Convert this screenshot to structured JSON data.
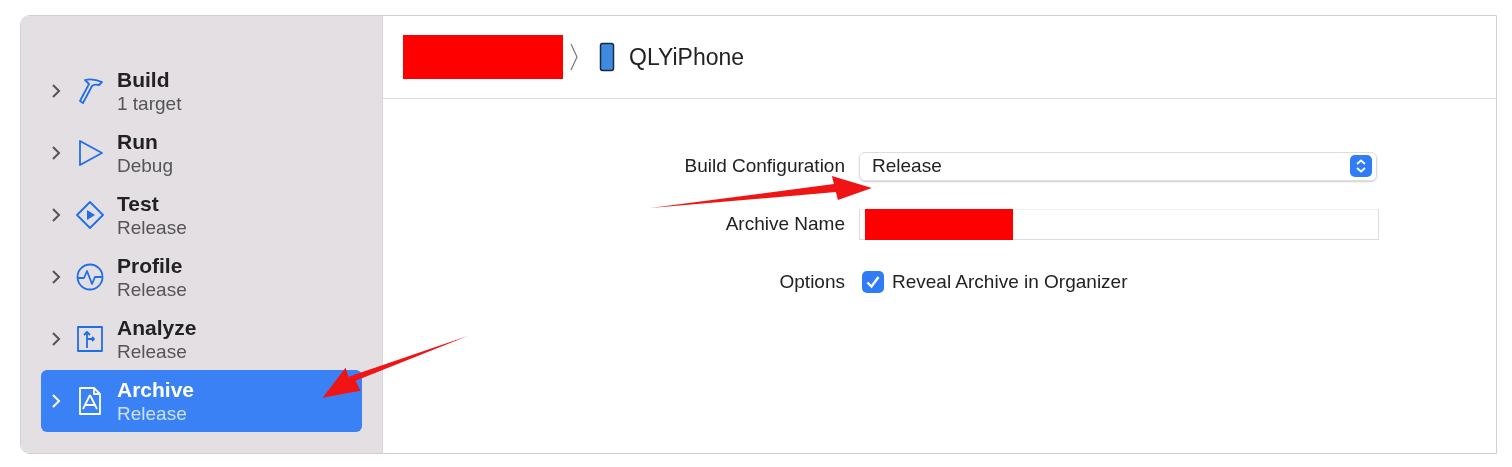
{
  "sidebar": {
    "items": [
      {
        "title": "Build",
        "subtitle": "1 target",
        "kind": "build",
        "selected": false
      },
      {
        "title": "Run",
        "subtitle": "Debug",
        "kind": "run",
        "selected": false
      },
      {
        "title": "Test",
        "subtitle": "Release",
        "kind": "test",
        "selected": false
      },
      {
        "title": "Profile",
        "subtitle": "Release",
        "kind": "profile",
        "selected": false
      },
      {
        "title": "Analyze",
        "subtitle": "Release",
        "kind": "analyze",
        "selected": false
      },
      {
        "title": "Archive",
        "subtitle": "Release",
        "kind": "archive",
        "selected": true
      }
    ]
  },
  "breadcrumb": {
    "device": "QLYiPhone"
  },
  "form": [
    {
      "kind": "popup",
      "label": "Build Configuration",
      "value": "Release"
    },
    {
      "kind": "text",
      "label": "Archive Name"
    },
    {
      "kind": "checkbox",
      "label": "Options",
      "text": "Reveal Archive in Organizer",
      "checked": true
    }
  ]
}
